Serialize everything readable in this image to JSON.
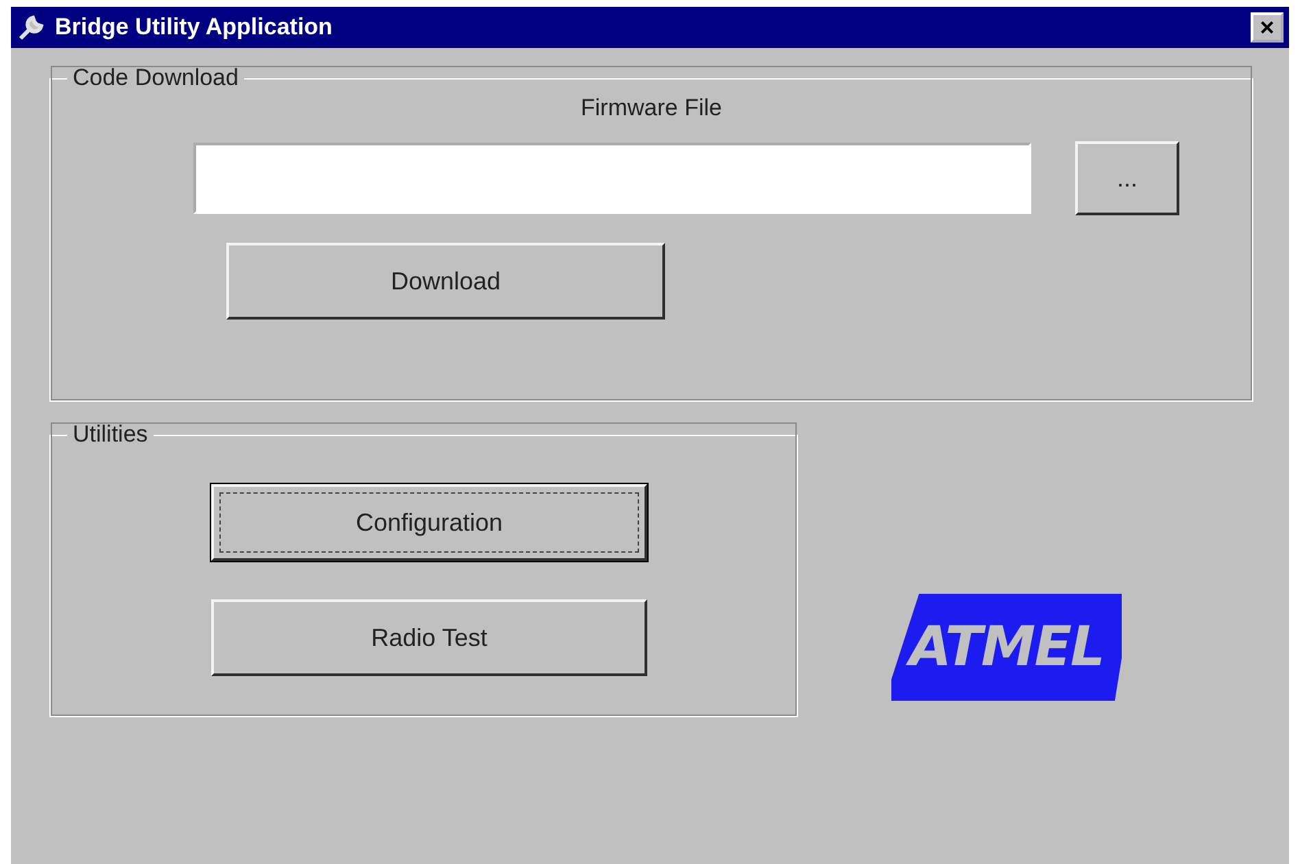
{
  "window": {
    "title": "Bridge Utility Application",
    "close_button": "×"
  },
  "code_download": {
    "title": "Code Download",
    "field_label": "Firmware File",
    "browse_button": "...",
    "download_button": "Download"
  },
  "utilities": {
    "title": "Utilities",
    "buttons": [
      {
        "label": "Configuration",
        "focused": true
      },
      {
        "label": "Radio Test",
        "focused": false
      }
    ]
  },
  "logo": {
    "text": "ATMEL"
  }
}
